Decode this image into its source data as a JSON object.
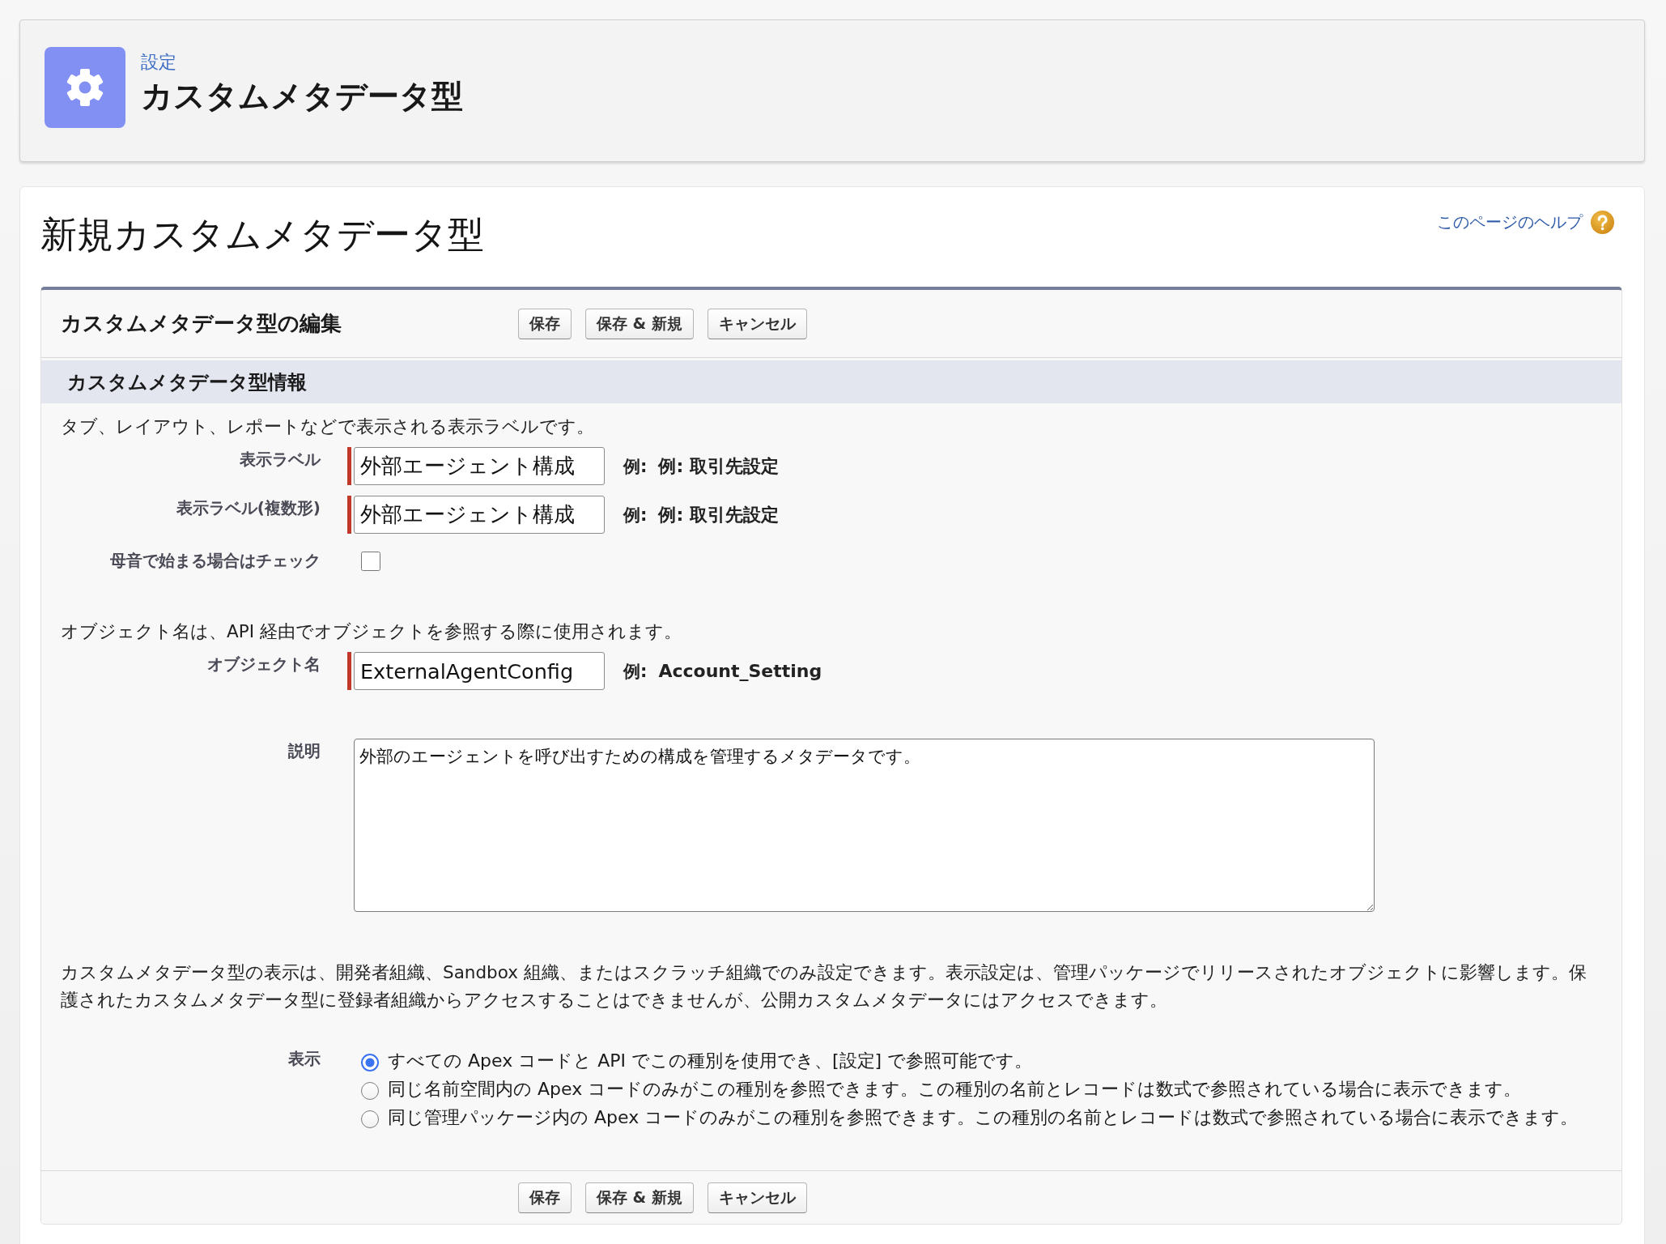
{
  "header": {
    "breadcrumb": "設定",
    "title": "カスタムメタデータ型"
  },
  "page_title": "新規カスタムメタデータ型",
  "help_link": "このページのヘルプ",
  "edit_panel": {
    "title": "カスタムメタデータ型の編集",
    "top_buttons": [
      {
        "label": "保存"
      },
      {
        "label": "保存 & 新規"
      },
      {
        "label": "キャンセル"
      }
    ],
    "section_title": "カスタムメタデータ型情報",
    "fields": [
      {
        "kind": "note",
        "text": "タブ、レイアウト、レポートなどで表示される表示ラベルです。"
      },
      {
        "kind": "text",
        "label": "表示ラベル",
        "value": "外部エージェント構成",
        "required": true,
        "example_prefix": "例:",
        "example": "例: 取引先設定"
      },
      {
        "kind": "text",
        "label": "表示ラベル(複数形)",
        "value": "外部エージェント構成",
        "required": true,
        "example_prefix": "例:",
        "example": "例: 取引先設定"
      },
      {
        "kind": "checkbox",
        "label": "母音で始まる場合はチェック",
        "checked": false
      },
      {
        "kind": "note",
        "text": "オブジェクト名は、API 経由でオブジェクトを参照する際に使用されます。"
      },
      {
        "kind": "text",
        "label": "オブジェクト名",
        "value": "ExternalAgentConfig",
        "required": true,
        "example_prefix": "例:",
        "example": "Account_Setting"
      },
      {
        "kind": "textarea",
        "label": "説明",
        "value": "外部のエージェントを呼び出すための構成を管理するメタデータです。"
      },
      {
        "kind": "note",
        "text": "カスタムメタデータ型の表示は、開発者組織、Sandbox 組織、またはスクラッチ組織でのみ設定できます。表示設定は、管理パッケージでリリースされたオブジェクトに影響します。保護されたカスタムメタデータ型に登録者組織からアクセスすることはできませんが、公開カスタムメタデータにはアクセスできます。"
      },
      {
        "kind": "radio",
        "label": "表示",
        "options": [
          {
            "label": "すべての Apex コードと API でこの種別を使用でき、[設定] で参照可能です。",
            "selected": true
          },
          {
            "label": "同じ名前空間内の Apex コードのみがこの種別を参照できます。この種別の名前とレコードは数式で参照されている場合に表示できます。",
            "selected": false
          },
          {
            "label": "同じ管理パッケージ内の Apex コードのみがこの種別を参照できます。この種別の名前とレコードは数式で参照されている場合に表示できます。",
            "selected": false
          }
        ]
      }
    ],
    "bottom_buttons": [
      {
        "label": "保存"
      },
      {
        "label": "保存 & 新規"
      },
      {
        "label": "キャンセル"
      }
    ]
  }
}
